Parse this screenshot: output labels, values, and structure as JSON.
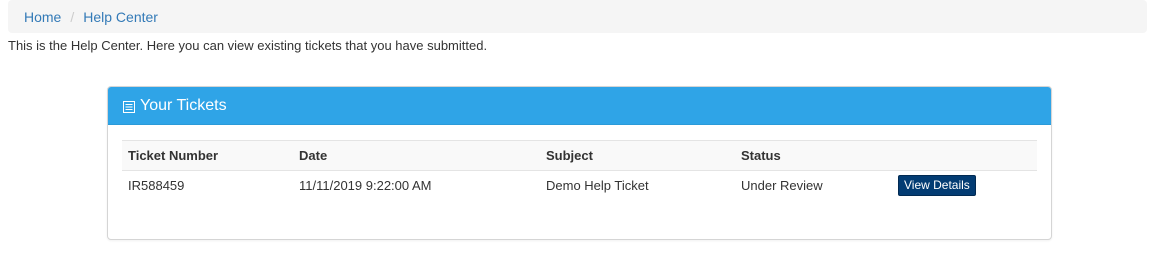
{
  "breadcrumb": {
    "items": [
      {
        "label": "Home"
      },
      {
        "label": "Help Center"
      }
    ],
    "separator": "/"
  },
  "intro_text": "This is the Help Center. Here you can view existing tickets that you have submitted.",
  "panel": {
    "title": "Your Tickets",
    "icon": "list-icon",
    "header_color": "#2fa4e7"
  },
  "table": {
    "headers": [
      "Ticket Number",
      "Date",
      "Subject",
      "Status",
      ""
    ],
    "rows": [
      {
        "ticket_number": "IR588459",
        "date": "11/11/2019 9:22:00 AM",
        "subject": "Demo Help Ticket",
        "status": "Under Review",
        "action_label": "View Details"
      }
    ]
  },
  "colors": {
    "link": "#337ab7",
    "button": "#033c73"
  }
}
